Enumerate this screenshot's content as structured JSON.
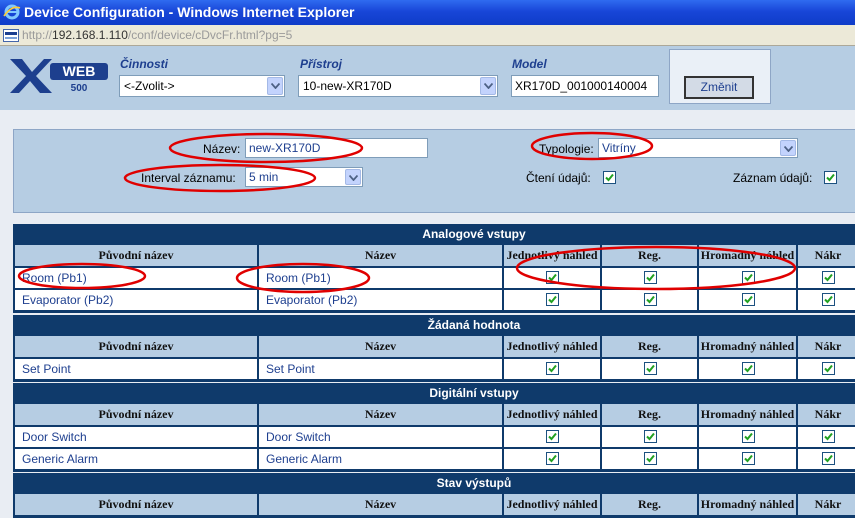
{
  "window": {
    "title": "Device Configuration - Windows Internet Explorer"
  },
  "address": {
    "prefix": "http://",
    "host": "192.168.1.110",
    "path": "/conf/device/cDvcFr.html?pg=5"
  },
  "header": {
    "logo_text": "XWEB 500",
    "cinnosti_label": "Činnosti",
    "cinnosti_value": "<-Zvolit->",
    "pristroj_label": "Přístroj",
    "pristroj_value": "10-new-XR170D",
    "model_label": "Model",
    "model_value": "XR170D_001000140004",
    "change_button": "Změnit"
  },
  "config": {
    "name_label": "Název:",
    "name_value": "new-XR170D",
    "typology_label": "Typologie:",
    "typology_value": "Vitríny",
    "interval_label": "Interval záznamu:",
    "interval_value": "5 min",
    "read_label": "Čtení údajů:",
    "read_checked": true,
    "record_label": "Záznam údajů:",
    "record_checked": true
  },
  "columns": [
    "Původní název",
    "Název",
    "Jednotlivý náhled",
    "Reg.",
    "Hromadný náhled",
    "Nákr"
  ],
  "sections": [
    {
      "title": "Analogové vstupy",
      "rows": [
        {
          "original": "Room (Pb1)",
          "name": "Room (Pb1)"
        },
        {
          "original": "Evaporator (Pb2)",
          "name": "Evaporator (Pb2)"
        }
      ]
    },
    {
      "title": "Žádaná hodnota",
      "rows": [
        {
          "original": "Set Point",
          "name": "Set Point"
        }
      ]
    },
    {
      "title": "Digitální vstupy",
      "rows": [
        {
          "original": "Door Switch",
          "name": "Door Switch"
        },
        {
          "original": "Generic Alarm",
          "name": "Generic Alarm"
        }
      ]
    },
    {
      "title": "Stav výstupů",
      "rows": []
    }
  ],
  "colors": {
    "accent": "#0f3a6b",
    "panel": "#b6cde3",
    "link": "#1e3f8f",
    "annotation": "#e00000"
  }
}
